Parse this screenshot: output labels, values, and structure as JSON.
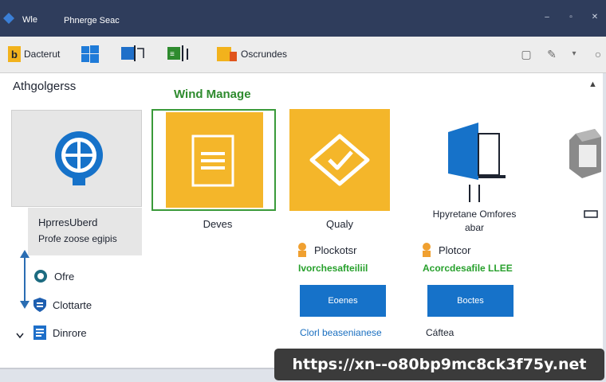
{
  "window": {
    "app_label": "Wle",
    "title": "Phnerge Seac",
    "controls": {
      "minimize": "–",
      "maximize": "▫",
      "close": "✕"
    }
  },
  "toolbar": {
    "items": [
      {
        "icon": "folder-b-icon",
        "label": "Dacterut"
      },
      {
        "icon": "windows-icon",
        "label": ""
      },
      {
        "icon": "monitor-grid-icon",
        "label": ""
      },
      {
        "icon": "sheet-icon",
        "label": ""
      },
      {
        "icon": "folder-icon",
        "label": "Oscrundes"
      }
    ],
    "right_icons": [
      "window-icon",
      "edit-icon",
      "chevron-icon",
      "search-icon"
    ]
  },
  "panel": {
    "title": "Athgolgerss",
    "section_title": "Wind Manage",
    "left": {
      "name": "HprresUberd",
      "sub": "Profe zoose egipis",
      "nav": [
        {
          "icon": "circle-icon",
          "label": "Ofre"
        },
        {
          "icon": "shield-icon",
          "label": "Clottarte"
        },
        {
          "icon": "doc-shield-icon",
          "label": "Dinrore"
        }
      ]
    },
    "tiles": [
      {
        "label": "Deves",
        "color": "#f4b62a"
      },
      {
        "label": "Qualy",
        "color": "#f4b62a"
      },
      {
        "label": "Hpyretane Omfores\nabar",
        "color": "#1672c9"
      }
    ],
    "columns": [
      {
        "info_label": "Plockotsr",
        "link": "Ivorchesafteiliil",
        "button": "Eoenes",
        "footer": "Clorl beasenianese"
      },
      {
        "info_label": "Plotcor",
        "link": "Acorcdesafile LLEE",
        "button": "Boctes",
        "footer": "Cáftea"
      }
    ]
  },
  "banner": {
    "url": "https://xn--o80bp9mc8ck3f75y.net"
  },
  "colors": {
    "titlebar": "#2f3d5c",
    "accent_yellow": "#f4b62a",
    "accent_blue": "#1672c9",
    "accent_green": "#27a02c"
  }
}
